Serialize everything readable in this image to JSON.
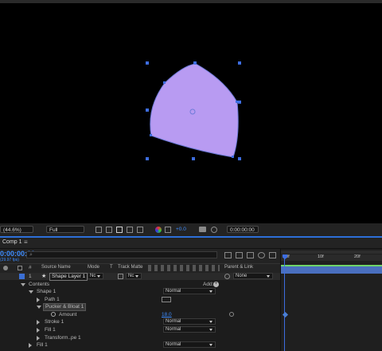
{
  "viewer": {
    "shape_fill": "#b89bf2",
    "shape_stroke": "#6d7ad8",
    "handle_color": "#3d6de0"
  },
  "viewer_toolbar": {
    "zoom": "(44.6%)",
    "resolution": "Full",
    "exposure": "+0.0",
    "timecode": "0:00:00:00"
  },
  "comp_tab": {
    "label": "Comp 1",
    "menu_icon": "hamburger-icon"
  },
  "timeline": {
    "current_time": "0:00:00:00",
    "fps": "(29.97 fps)",
    "search_placeholder": "",
    "columns": {
      "source_name": "Source Name",
      "mode": "Mode",
      "t": "T",
      "track_matte": "Track Matte",
      "parent_link": "Parent & Link"
    },
    "layer": {
      "number": "1",
      "name": "Shape Layer 1",
      "mode": "Nc",
      "track_matte": "Nc",
      "parent": "None"
    },
    "rows": {
      "contents": "Contents",
      "add_label": "Add:",
      "shape1": "Shape 1",
      "shape1_blend": "Normal",
      "path1": "Path 1",
      "pucker": "Pucker & Bloat 1",
      "amount": "Amount",
      "amount_value": "18.0",
      "stroke1": "Stroke 1",
      "stroke_blend": "Normal",
      "fill1": "Fill 1",
      "fill_blend": "Normal",
      "transform": "Transform..pe 1",
      "fill1_outer": "Fill 1",
      "fill_outer_blend": "Normal"
    },
    "ruler": {
      "marks": [
        "00f",
        "10f",
        "20f"
      ]
    },
    "colors": {
      "accent": "#2d6fd8",
      "layer_bar": "#4a6fbf",
      "layer_bar_top": "#6fd46a"
    }
  }
}
